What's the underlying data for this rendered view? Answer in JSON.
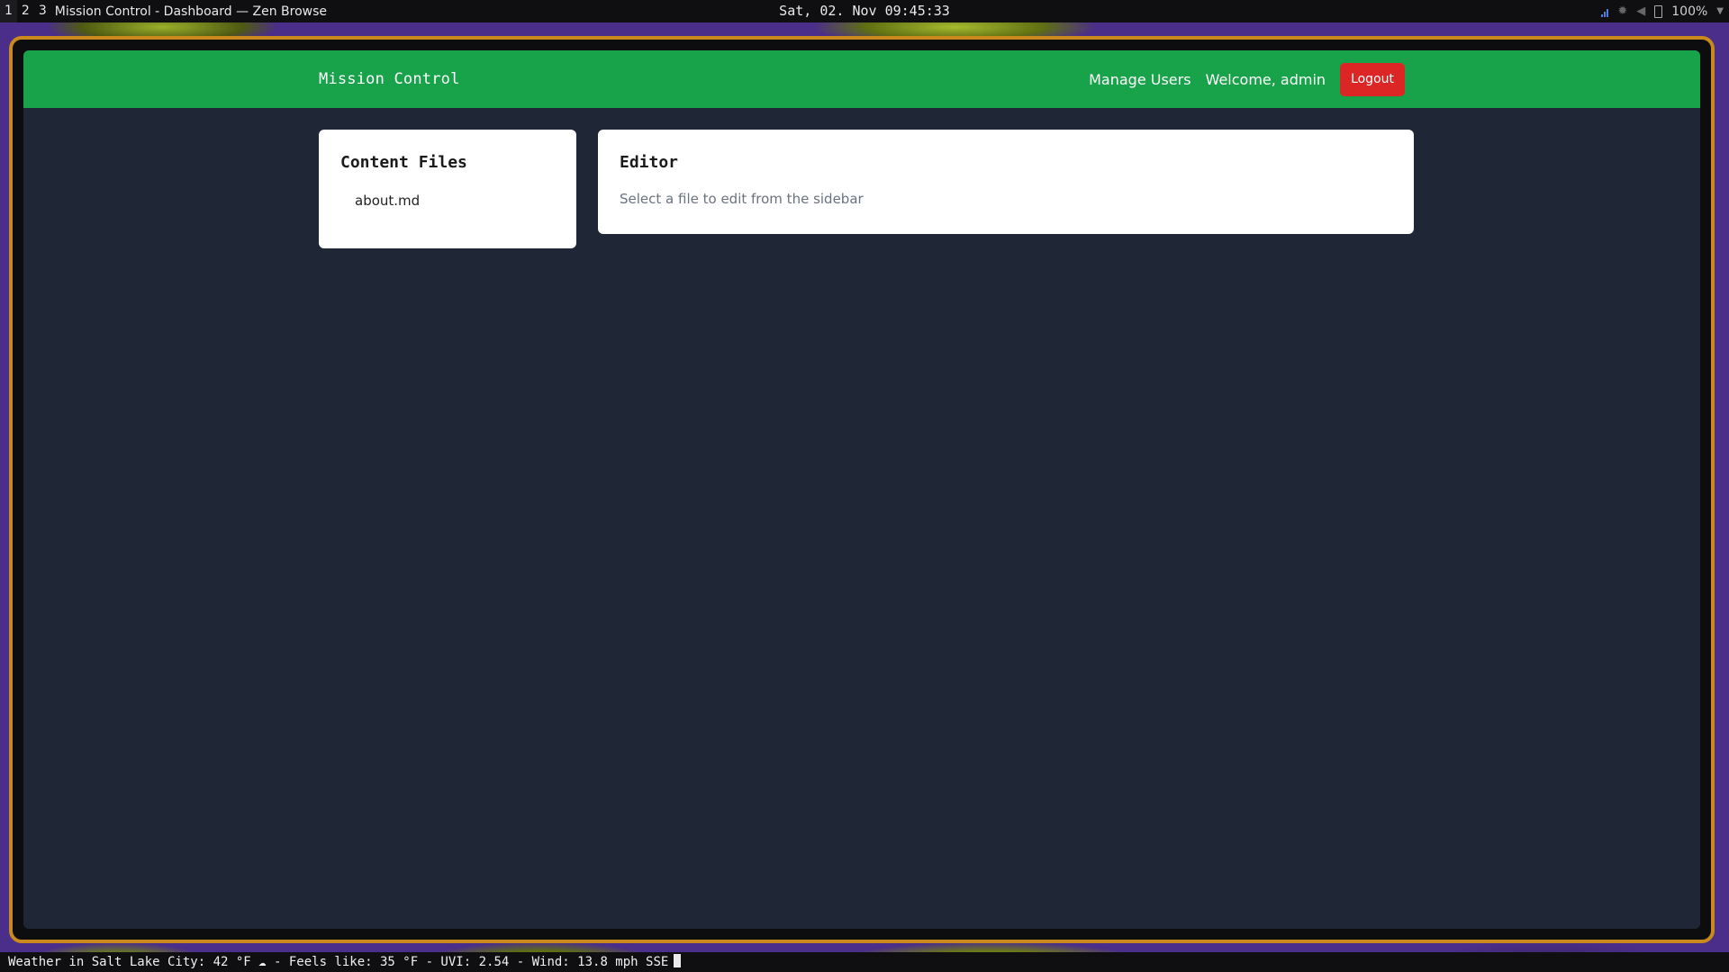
{
  "system_bar": {
    "workspaces": [
      "1",
      "2",
      "3"
    ],
    "active_workspace": "1",
    "window_title": "Mission Control - Dashboard — Zen Browse",
    "clock": "Sat, 02. Nov  09:45:33",
    "battery": "100%"
  },
  "app": {
    "brand": "Mission Control",
    "nav": {
      "manage_users": "Manage Users",
      "welcome": "Welcome, admin",
      "logout": "Logout"
    },
    "sidebar": {
      "title": "Content Files",
      "files": [
        "about.md"
      ]
    },
    "editor": {
      "title": "Editor",
      "hint": "Select a file to edit from the sidebar"
    },
    "colors": {
      "navbar": "#18a34a",
      "logout": "#dc2626",
      "background": "#1f2636",
      "frame_border": "#c98a1b"
    }
  },
  "status_bar": {
    "weather": "Weather in Salt Lake City: 42 °F ☁ - Feels like: 35 °F - UVI: 2.54 - Wind: 13.8 mph SSE"
  }
}
